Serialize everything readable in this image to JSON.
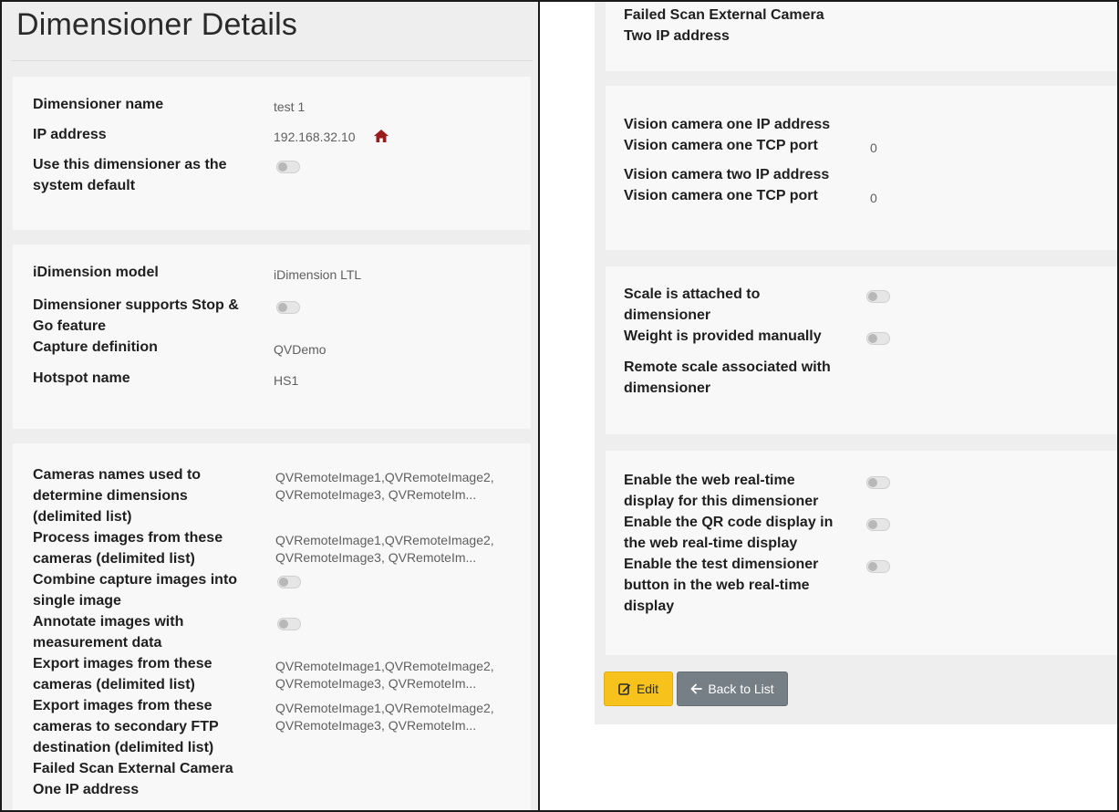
{
  "page": {
    "title": "Dimensioner Details"
  },
  "general": {
    "name_label": "Dimensioner name",
    "name_value": "test 1",
    "ip_label": "IP address",
    "ip_value": "192.168.32.10",
    "default_label_1": "Use this dimensioner as the",
    "default_label_2": "system default"
  },
  "model": {
    "model_label": "iDimension model",
    "model_value": "iDimension LTL",
    "stopgo_label_1": "Dimensioner supports Stop &",
    "stopgo_label_2": "Go feature",
    "capture_label": "Capture definition",
    "capture_value": "QVDemo",
    "hotspot_label": "Hotspot name",
    "hotspot_value": "HS1"
  },
  "cameras": {
    "names_label_1": "Cameras names used to",
    "names_label_2": "determine dimensions",
    "names_label_3": "(delimited list)",
    "names_value_1": "QVRemoteImage1,QVRemoteImage2,",
    "names_value_2": "QVRemoteImage3, QVRemoteIm...",
    "process_label_1": "Process images from these",
    "process_label_2": "cameras (delimited list)",
    "process_value_1": "QVRemoteImage1,QVRemoteImage2,",
    "process_value_2": "QVRemoteImage3, QVRemoteIm...",
    "combine_label_1": "Combine capture images into",
    "combine_label_2": "single image",
    "annotate_label_1": "Annotate images with",
    "annotate_label_2": "measurement data",
    "export_label_1": "Export images from these",
    "export_label_2": "cameras (delimited list)",
    "export_value_1": "QVRemoteImage1,QVRemoteImage2,",
    "export_value_2": "QVRemoteImage3, QVRemoteIm...",
    "ftp_label_1": "Export images from these",
    "ftp_label_2": "cameras to secondary FTP",
    "ftp_label_3": "destination (delimited list)",
    "ftp_value_1": "QVRemoteImage1,QVRemoteImage2,",
    "ftp_value_2": "QVRemoteImage3, QVRemoteIm...",
    "failed1_label_1": "Failed Scan External Camera",
    "failed1_label_2": "One IP address",
    "failed2_label_1": "Failed Scan External Camera",
    "failed2_label_2": "Two IP address"
  },
  "vision": {
    "cam1_ip_label": "Vision camera one IP address",
    "cam1_port_label": "Vision camera one TCP port",
    "cam1_port_value": "0",
    "cam2_ip_label": "Vision camera two IP address",
    "cam2_port_label": "Vision camera one TCP port",
    "cam2_port_value": "0"
  },
  "scale": {
    "attached_label_1": "Scale is attached to",
    "attached_label_2": "dimensioner",
    "manual_label": "Weight is provided manually",
    "remote_label_1": "Remote scale associated with",
    "remote_label_2": "dimensioner"
  },
  "web": {
    "realtime_label_1": "Enable the web real-time",
    "realtime_label_2": "display for this dimensioner",
    "qr_label_1": "Enable the QR code display in",
    "qr_label_2": "the web real-time display",
    "test_label_1": "Enable the test dimensioner",
    "test_label_2": "button in the web real-time",
    "test_label_3": "display"
  },
  "actions": {
    "edit_label": "Edit",
    "back_label": "Back to List"
  },
  "colors": {
    "edit_button": "#f6c21b",
    "back_button": "#777f86",
    "home_icon": "#9b1c1c"
  }
}
